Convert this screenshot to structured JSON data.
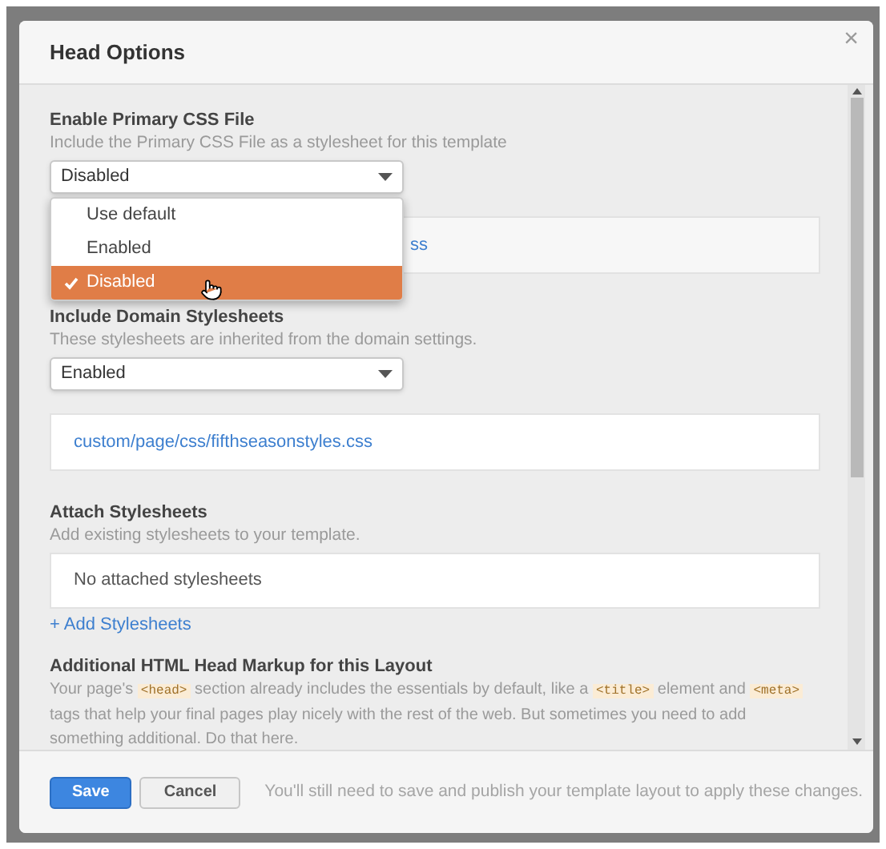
{
  "dialog": {
    "title": "Head Options",
    "close": "×"
  },
  "primary_css": {
    "heading": "Enable Primary CSS File",
    "description": "Include the Primary CSS File as a stylesheet for this template",
    "select_value": "Disabled",
    "link_visible": "ss",
    "menu": [
      {
        "label": "Use default",
        "selected": false
      },
      {
        "label": "Enabled",
        "selected": false
      },
      {
        "label": "Disabled",
        "selected": true
      }
    ]
  },
  "domain_stylesheets": {
    "heading": "Include Domain Stylesheets",
    "description": "These stylesheets are inherited from the domain settings.",
    "select_value": "Enabled",
    "links": [
      "custom/page/css/fifthseasonstyles.css"
    ]
  },
  "attach_stylesheets": {
    "heading": "Attach Stylesheets",
    "description": "Add existing stylesheets to your template.",
    "empty_text": "No attached stylesheets",
    "add_link": "+ Add Stylesheets"
  },
  "head_markup": {
    "heading": "Additional HTML Head Markup for this Layout",
    "description": [
      {
        "kind": "text",
        "text": "Your page's "
      },
      {
        "kind": "code",
        "text": "<head>"
      },
      {
        "kind": "text",
        "text": " section already includes the essentials by default, like a "
      },
      {
        "kind": "code",
        "text": "<title>"
      },
      {
        "kind": "text",
        "text": " element and "
      },
      {
        "kind": "code",
        "text": "<meta>"
      },
      {
        "kind": "text",
        "text": " tags that help your final pages play nicely with the rest of the web. But sometimes you need to add something additional. Do that here."
      }
    ]
  },
  "footer": {
    "buttons": [
      {
        "label": "Save",
        "kind": "primary"
      },
      {
        "label": "Cancel",
        "kind": "secondary"
      }
    ],
    "note": "You'll still need to save and publish your template layout to apply these changes."
  }
}
